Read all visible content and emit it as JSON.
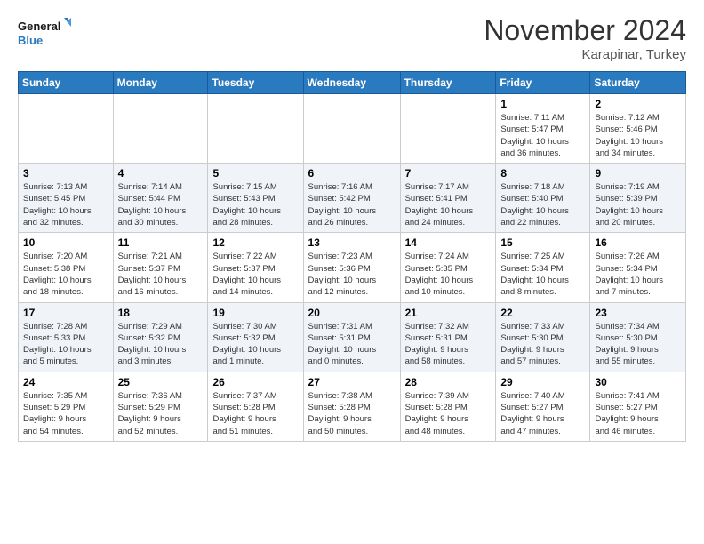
{
  "header": {
    "logo_line1": "General",
    "logo_line2": "Blue",
    "month": "November 2024",
    "location": "Karapinar, Turkey"
  },
  "weekdays": [
    "Sunday",
    "Monday",
    "Tuesday",
    "Wednesday",
    "Thursday",
    "Friday",
    "Saturday"
  ],
  "weeks": [
    [
      {
        "day": "",
        "info": ""
      },
      {
        "day": "",
        "info": ""
      },
      {
        "day": "",
        "info": ""
      },
      {
        "day": "",
        "info": ""
      },
      {
        "day": "",
        "info": ""
      },
      {
        "day": "1",
        "info": "Sunrise: 7:11 AM\nSunset: 5:47 PM\nDaylight: 10 hours\nand 36 minutes."
      },
      {
        "day": "2",
        "info": "Sunrise: 7:12 AM\nSunset: 5:46 PM\nDaylight: 10 hours\nand 34 minutes."
      }
    ],
    [
      {
        "day": "3",
        "info": "Sunrise: 7:13 AM\nSunset: 5:45 PM\nDaylight: 10 hours\nand 32 minutes."
      },
      {
        "day": "4",
        "info": "Sunrise: 7:14 AM\nSunset: 5:44 PM\nDaylight: 10 hours\nand 30 minutes."
      },
      {
        "day": "5",
        "info": "Sunrise: 7:15 AM\nSunset: 5:43 PM\nDaylight: 10 hours\nand 28 minutes."
      },
      {
        "day": "6",
        "info": "Sunrise: 7:16 AM\nSunset: 5:42 PM\nDaylight: 10 hours\nand 26 minutes."
      },
      {
        "day": "7",
        "info": "Sunrise: 7:17 AM\nSunset: 5:41 PM\nDaylight: 10 hours\nand 24 minutes."
      },
      {
        "day": "8",
        "info": "Sunrise: 7:18 AM\nSunset: 5:40 PM\nDaylight: 10 hours\nand 22 minutes."
      },
      {
        "day": "9",
        "info": "Sunrise: 7:19 AM\nSunset: 5:39 PM\nDaylight: 10 hours\nand 20 minutes."
      }
    ],
    [
      {
        "day": "10",
        "info": "Sunrise: 7:20 AM\nSunset: 5:38 PM\nDaylight: 10 hours\nand 18 minutes."
      },
      {
        "day": "11",
        "info": "Sunrise: 7:21 AM\nSunset: 5:37 PM\nDaylight: 10 hours\nand 16 minutes."
      },
      {
        "day": "12",
        "info": "Sunrise: 7:22 AM\nSunset: 5:37 PM\nDaylight: 10 hours\nand 14 minutes."
      },
      {
        "day": "13",
        "info": "Sunrise: 7:23 AM\nSunset: 5:36 PM\nDaylight: 10 hours\nand 12 minutes."
      },
      {
        "day": "14",
        "info": "Sunrise: 7:24 AM\nSunset: 5:35 PM\nDaylight: 10 hours\nand 10 minutes."
      },
      {
        "day": "15",
        "info": "Sunrise: 7:25 AM\nSunset: 5:34 PM\nDaylight: 10 hours\nand 8 minutes."
      },
      {
        "day": "16",
        "info": "Sunrise: 7:26 AM\nSunset: 5:34 PM\nDaylight: 10 hours\nand 7 minutes."
      }
    ],
    [
      {
        "day": "17",
        "info": "Sunrise: 7:28 AM\nSunset: 5:33 PM\nDaylight: 10 hours\nand 5 minutes."
      },
      {
        "day": "18",
        "info": "Sunrise: 7:29 AM\nSunset: 5:32 PM\nDaylight: 10 hours\nand 3 minutes."
      },
      {
        "day": "19",
        "info": "Sunrise: 7:30 AM\nSunset: 5:32 PM\nDaylight: 10 hours\nand 1 minute."
      },
      {
        "day": "20",
        "info": "Sunrise: 7:31 AM\nSunset: 5:31 PM\nDaylight: 10 hours\nand 0 minutes."
      },
      {
        "day": "21",
        "info": "Sunrise: 7:32 AM\nSunset: 5:31 PM\nDaylight: 9 hours\nand 58 minutes."
      },
      {
        "day": "22",
        "info": "Sunrise: 7:33 AM\nSunset: 5:30 PM\nDaylight: 9 hours\nand 57 minutes."
      },
      {
        "day": "23",
        "info": "Sunrise: 7:34 AM\nSunset: 5:30 PM\nDaylight: 9 hours\nand 55 minutes."
      }
    ],
    [
      {
        "day": "24",
        "info": "Sunrise: 7:35 AM\nSunset: 5:29 PM\nDaylight: 9 hours\nand 54 minutes."
      },
      {
        "day": "25",
        "info": "Sunrise: 7:36 AM\nSunset: 5:29 PM\nDaylight: 9 hours\nand 52 minutes."
      },
      {
        "day": "26",
        "info": "Sunrise: 7:37 AM\nSunset: 5:28 PM\nDaylight: 9 hours\nand 51 minutes."
      },
      {
        "day": "27",
        "info": "Sunrise: 7:38 AM\nSunset: 5:28 PM\nDaylight: 9 hours\nand 50 minutes."
      },
      {
        "day": "28",
        "info": "Sunrise: 7:39 AM\nSunset: 5:28 PM\nDaylight: 9 hours\nand 48 minutes."
      },
      {
        "day": "29",
        "info": "Sunrise: 7:40 AM\nSunset: 5:27 PM\nDaylight: 9 hours\nand 47 minutes."
      },
      {
        "day": "30",
        "info": "Sunrise: 7:41 AM\nSunset: 5:27 PM\nDaylight: 9 hours\nand 46 minutes."
      }
    ]
  ]
}
